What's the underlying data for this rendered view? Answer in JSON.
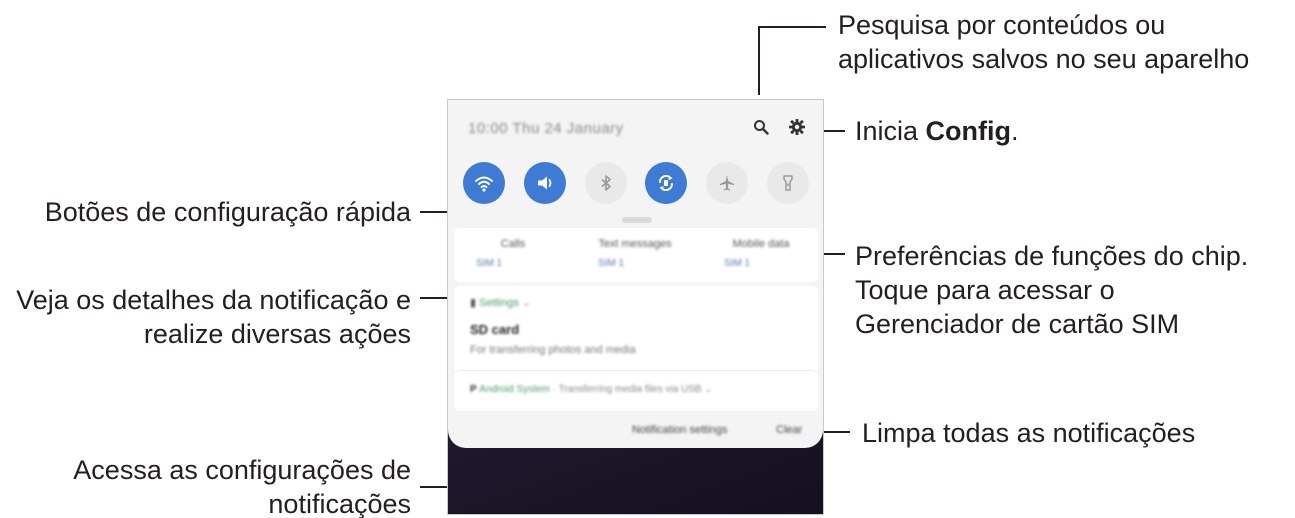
{
  "callouts": {
    "search": [
      "Pesquisa por conteúdos ou",
      "aplicativos salvos no seu aparelho"
    ],
    "settings_prefix": "Inicia ",
    "settings_bold": "Config",
    "settings_suffix": ".",
    "quick_buttons": "Botões de configuração rápida",
    "sim": [
      "Preferências de funções do chip.",
      "Toque para acessar o",
      "Gerenciador de cartão SIM"
    ],
    "notification_detail": [
      "Veja os detalhes da notificação e",
      "realize diversas ações"
    ],
    "clear": "Limpa todas as notificações",
    "notification_settings": [
      "Acessa as configurações de",
      "notificações"
    ]
  },
  "phone": {
    "status_text": "10:00  Thu 24 January",
    "icons": [
      "search-icon",
      "gear-icon"
    ],
    "quick_settings": [
      {
        "icon": "wifi-icon",
        "state": "on"
      },
      {
        "icon": "sound-icon",
        "state": "on"
      },
      {
        "icon": "bluetooth-icon",
        "state": "off"
      },
      {
        "icon": "auto-rotate-icon",
        "state": "on"
      },
      {
        "icon": "airplane-icon",
        "state": "off"
      },
      {
        "icon": "flashlight-icon",
        "state": "off"
      }
    ],
    "sim_prefs": [
      {
        "title": "Calls",
        "sim": "SIM 1"
      },
      {
        "title": "Text messages",
        "sim": "SIM 1"
      },
      {
        "title": "Mobile data",
        "sim": "SIM 1"
      }
    ],
    "notification": {
      "app": "Settings",
      "title": "SD card",
      "text": "For transferring photos and media"
    },
    "notification2": {
      "app": "Android System",
      "text": "Transferring media files via USB"
    },
    "bottom": {
      "settings": "Notification settings",
      "clear": "Clear"
    },
    "accent_color": "#3e7bd4"
  }
}
